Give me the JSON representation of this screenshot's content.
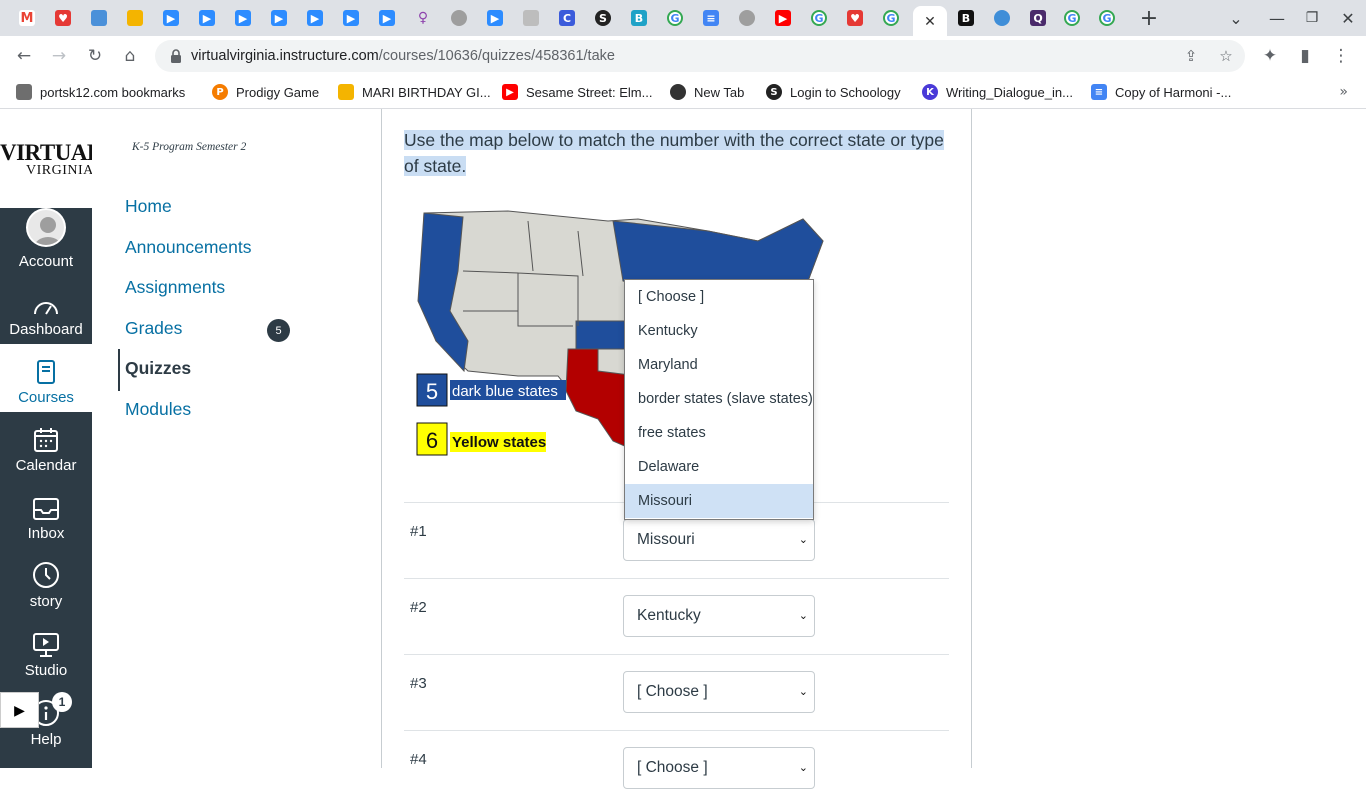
{
  "browser": {
    "tab_count": 31,
    "new_tab": "+",
    "url_host": "virtualvirginia.instructure.com",
    "url_path": "/courses/10636/quizzes/458361/take"
  },
  "bookmarks": [
    {
      "label": "portsk12.com bookmarks",
      "icon": "folder-icon",
      "color": "#f4b400"
    },
    {
      "label": "Prodigy Game",
      "icon": "prodigy-icon",
      "color": "#f57c00"
    },
    {
      "label": "MARI BIRTHDAY GI...",
      "icon": "folder-icon",
      "color": "#f4b400"
    },
    {
      "label": "Sesame Street: Elm...",
      "icon": "youtube-icon",
      "color": "#ff0000"
    },
    {
      "label": "New Tab",
      "icon": "globe-icon",
      "color": "#333333"
    },
    {
      "label": "Login to Schoology",
      "icon": "schoology-icon",
      "color": "#222222"
    },
    {
      "label": "Writing_Dialogue_in...",
      "icon": "kami-icon",
      "color": "#4a3ad8"
    },
    {
      "label": "Copy of Harmoni -...",
      "icon": "docs-icon",
      "color": "#4285f4"
    }
  ],
  "global_nav": {
    "logo_line1": "VIRTUAL",
    "logo_line2": "VIRGINIA",
    "items": [
      {
        "label": "Account",
        "icon": "account-icon"
      },
      {
        "label": "Dashboard",
        "icon": "dashboard-icon"
      },
      {
        "label": "Courses",
        "icon": "courses-icon"
      },
      {
        "label": "Calendar",
        "icon": "calendar-icon"
      },
      {
        "label": "Inbox",
        "icon": "inbox-icon"
      },
      {
        "label": "story",
        "icon": "history-icon"
      },
      {
        "label": "Studio",
        "icon": "studio-icon"
      },
      {
        "label": "Help",
        "icon": "help-icon"
      }
    ],
    "help_badge": "1",
    "play": "▶"
  },
  "course_nav": {
    "course_name": "K-5 Program Semester 2",
    "items": [
      "Home",
      "Announcements",
      "Assignments",
      "Grades",
      "Quizzes",
      "Modules"
    ],
    "grades_badge": "5"
  },
  "quiz": {
    "prompt": "Use the map below to match the number with the correct state or type of state.",
    "map_label5_num": "5",
    "map_label5_text": "dark blue states",
    "map_label6_num": "6",
    "map_label6_text": "Yellow states",
    "rows": [
      {
        "num": "#1",
        "value": "Missouri"
      },
      {
        "num": "#2",
        "value": "Kentucky"
      },
      {
        "num": "#3",
        "value": "[ Choose ]"
      },
      {
        "num": "#4",
        "value": "[ Choose ]"
      }
    ],
    "dropdown_options": [
      "[ Choose ]",
      "Kentucky",
      "Maryland",
      "border states (slave states)",
      "free states",
      "Delaware",
      "Missouri"
    ],
    "dropdown_highlighted": "Missouri"
  }
}
